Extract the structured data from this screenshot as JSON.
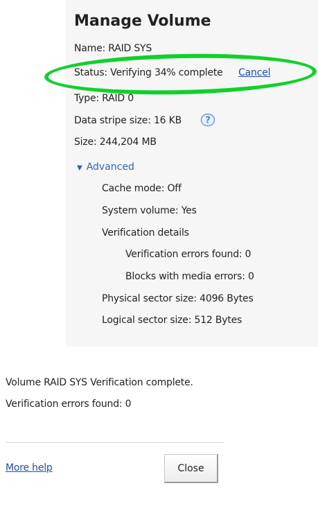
{
  "dialog": {
    "title": "Manage Volume",
    "name_line": "Name: RAID SYS",
    "status_line": "Status: Verifying 34% complete",
    "cancel_link": "Cancel",
    "type_line": "Type: RAID 0",
    "stripe_line": "Data stripe size: 16 KB",
    "size_line": "Size: 244,204 MB",
    "help_icon": "question-circle-icon"
  },
  "advanced": {
    "toggle_label": "Advanced",
    "cache_mode": "Cache mode: Off",
    "system_volume": "System volume: Yes",
    "verification_details": "Verification details",
    "verification_errors": "Verification errors found: 0",
    "media_errors": "Blocks with media errors: 0",
    "physical_sector": "Physical sector size: 4096 Bytes",
    "logical_sector": "Logical sector size: 512 Bytes"
  },
  "message": {
    "line1": "Volume RAID SYS Verification complete.",
    "line2": "Verification errors found: 0"
  },
  "footer": {
    "more_help": "More help",
    "close_label": "Close"
  },
  "colors": {
    "highlight_oval": "#10d12b",
    "link": "#1a4ea8",
    "panel_bg": "#f6f6f6"
  }
}
